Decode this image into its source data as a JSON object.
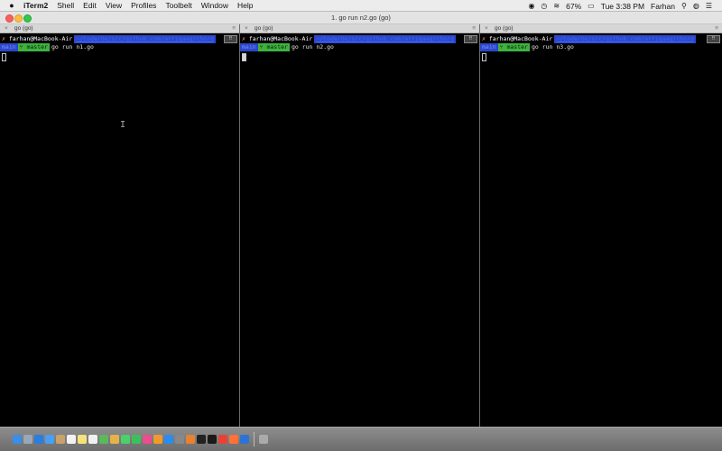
{
  "menubar": {
    "apple_icon": "apple-icon",
    "app_name": "iTerm2",
    "menus": [
      "Shell",
      "Edit",
      "View",
      "Profiles",
      "Toolbelt",
      "Window",
      "Help"
    ],
    "battery": "67%",
    "clock": "Tue 3:38 PM",
    "user": "Farhan"
  },
  "window": {
    "title": "1. go run n2.go (go)"
  },
  "panes": [
    {
      "header": "go (go)",
      "user_host": "farhan@MacBook-Air",
      "path": "~/Code/Go/src/github.com/arriqaaq/chord",
      "path_cont": "main",
      "branch": "master",
      "command": "go run n1.go"
    },
    {
      "header": "go (go)",
      "user_host": "farhan@MacBook-Air",
      "path": "~/Code/Go/src/github.com/arriqaaq/chord",
      "path_cont": "main",
      "branch": "master",
      "command": "go run n2.go"
    },
    {
      "header": "go (go)",
      "user_host": "farhan@MacBook-Air",
      "path": "~/Code/Go/src/github.com/arriqaaq/chord",
      "path_cont": "main",
      "branch": "master",
      "command": "go run n3.go"
    }
  ],
  "colors": {
    "path_bg": "#2c47c8",
    "vcs_bg": "#3fb23f",
    "terminal_bg": "#000000"
  },
  "dock": {
    "icons": [
      "finder",
      "launchpad",
      "safari",
      "mail",
      "contacts",
      "calendar",
      "notes",
      "reminders",
      "maps",
      "photos",
      "messages",
      "facetime",
      "itunes",
      "ibooks",
      "app-store",
      "system-preferences",
      "sublime-text",
      "terminal",
      "iterm2",
      "chrome",
      "firefox",
      "xcode",
      "trash"
    ]
  }
}
